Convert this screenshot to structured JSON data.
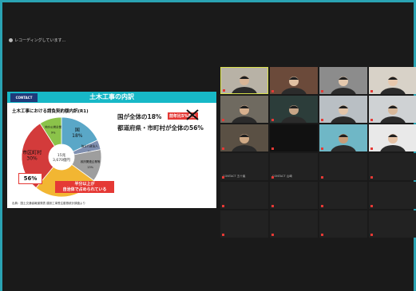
{
  "recording": {
    "label": "レコーディングしています..."
  },
  "slide": {
    "logo": "CONTACT",
    "title": "土木工事の内訳",
    "subtitle": "土木工事における請負契約額内訳(R1)",
    "center_total": "15兆",
    "center_sub": "3,670億円",
    "statement1": "国が全体の18%",
    "badge1": "前年比5%向上",
    "statement2": "都道府県・市町村が全体の56%",
    "pct_highlight": "56%",
    "half_note_line1": "半分以上が",
    "half_note_line2": "自治体で占められている",
    "source": "出典：国土交通省報道発表 建設工事受注動態統計調査より"
  },
  "chart_data": {
    "type": "pie",
    "title": "土木工事における請負契約額内訳(R1)",
    "slices": [
      {
        "label": "国",
        "value": 18,
        "value_label": "18%",
        "color": "#5aa7c7"
      },
      {
        "label": "独立行政法人",
        "value": 4,
        "value_label": "4%",
        "color": "#7f8fb0"
      },
      {
        "label": "政府関連企業等",
        "value": 13,
        "value_label": "13%",
        "color": "#9e9e9e"
      },
      {
        "label": "都道府県",
        "value": 26,
        "value_label": "26%",
        "color": "#f2b632"
      },
      {
        "label": "市区町村",
        "value": 30,
        "value_label": "30%",
        "color": "#d33b3b"
      },
      {
        "label": "地方公営企業",
        "value": 9,
        "value_label": "9%",
        "color": "#8bc34a"
      }
    ]
  },
  "participants": [
    {
      "name": "",
      "bg": "#b8b2a6",
      "skin": "#d8b596",
      "active": true
    },
    {
      "name": "",
      "bg": "#6b4a3a",
      "skin": "#e0c0a2"
    },
    {
      "name": "",
      "bg": "#8c8c8c",
      "skin": "#e5c9ae"
    },
    {
      "name": "",
      "bg": "#d8d2c8",
      "skin": "#e7c8ad"
    },
    {
      "name": "",
      "bg": "#6f6a60",
      "skin": "#d7b08e"
    },
    {
      "name": "",
      "bg": "#2c3d3a",
      "skin": "#c7a586"
    },
    {
      "name": "",
      "bg": "#b9bfc4",
      "skin": "#e2c4a8"
    },
    {
      "name": "",
      "bg": "#cfd2d4",
      "skin": "#d8b89a"
    },
    {
      "name": "",
      "bg": "#5a5044",
      "skin": "#d0aa86"
    },
    {
      "name": "",
      "bg": "#111111",
      "skin": "",
      "label": ""
    },
    {
      "name": "",
      "bg": "#6fb7c6",
      "skin": "#c79c78"
    },
    {
      "name": "",
      "bg": "#e9e9e9",
      "skin": "#e6c3a6"
    },
    {
      "name": "CONTACT 五十嵐",
      "bg": "#222",
      "skin": ""
    },
    {
      "name": "CONTACT 山崎",
      "bg": "#222",
      "skin": ""
    },
    {
      "name": "",
      "bg": "#222",
      "skin": ""
    },
    {
      "name": "",
      "bg": "#222",
      "skin": ""
    },
    {
      "name": "",
      "bg": "#222",
      "skin": ""
    },
    {
      "name": "",
      "bg": "#222",
      "skin": ""
    },
    {
      "name": "",
      "bg": "#222",
      "skin": ""
    },
    {
      "name": "",
      "bg": "#222",
      "skin": ""
    },
    {
      "name": "",
      "bg": "#222",
      "skin": ""
    },
    {
      "name": "",
      "bg": "#222",
      "skin": ""
    },
    {
      "name": "",
      "bg": "#222",
      "skin": ""
    },
    {
      "name": "",
      "bg": "#222",
      "skin": ""
    }
  ]
}
